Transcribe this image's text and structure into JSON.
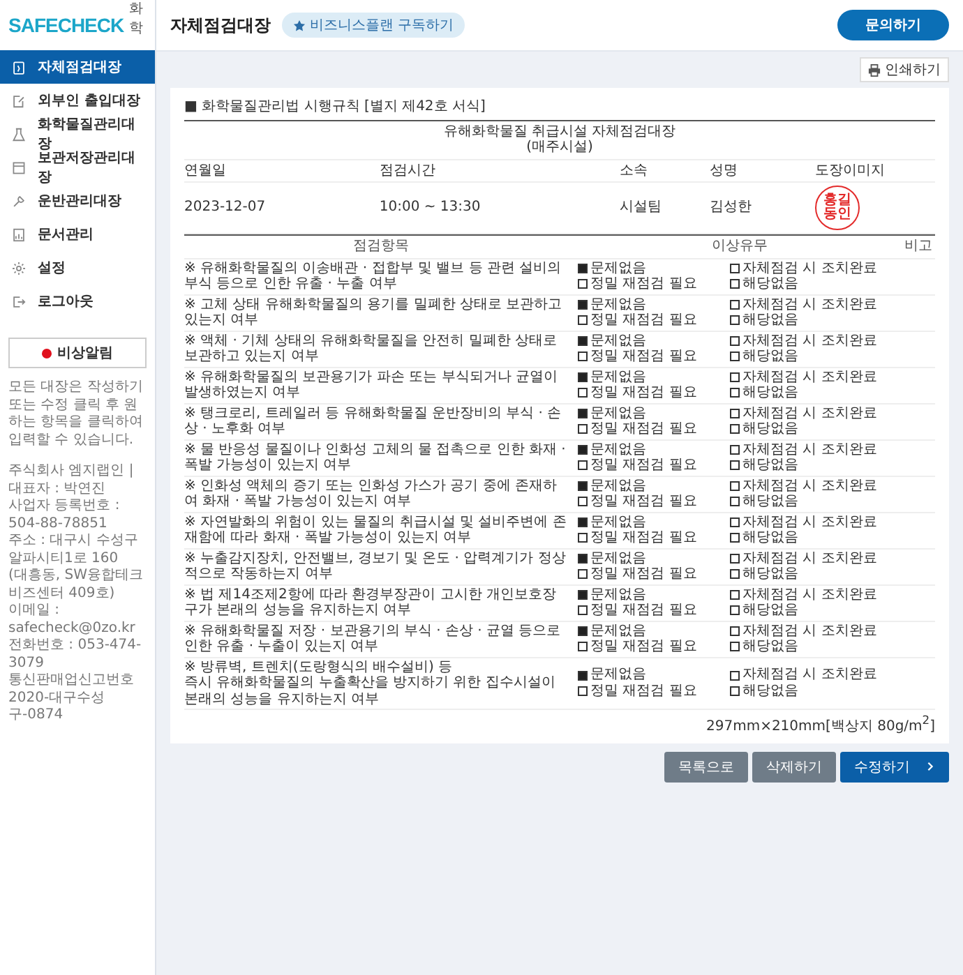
{
  "header": {
    "logo": "SAFECHECK",
    "logo_sub": "화학",
    "page_title": "자체점검대장",
    "subscribe_badge": "비즈니스플랜 구독하기",
    "contact_button": "문의하기"
  },
  "sidebar": {
    "items": [
      {
        "label": "자체점검대장",
        "selected": true
      },
      {
        "label": "외부인 출입대장",
        "selected": false
      },
      {
        "label": "화학물질관리대장",
        "selected": false
      },
      {
        "label": "보관저장관리대장",
        "selected": false
      },
      {
        "label": "운반관리대장",
        "selected": false
      },
      {
        "label": "문서관리",
        "selected": false
      },
      {
        "label": "설정",
        "selected": false
      },
      {
        "label": "로그아웃",
        "selected": false
      }
    ],
    "alert_button": "비상알림",
    "notice": "모든 대장은 작성하기또는 수정 클릭 후 원하는 항목을 클릭하여 입력할 수 있습니다.",
    "company_info": [
      "주식회사 엠지랩인 | 대표자 : 박연진",
      "사업자 등록번호 : 504-88-78851",
      "주소 : 대구시 수성구 알파시티1로 160",
      "(대흥동, SW융합테크비즈센터 409호)",
      "이메일 : safecheck@0zo.kr",
      "전화번호 : 053-474-3079",
      "통신판매업신고번호",
      "2020-대구수성구-0874"
    ]
  },
  "toolbar": {
    "print_button": "인쇄하기"
  },
  "form": {
    "legal_basis": "■ 화학물질관리법 시행규칙 [별지 제42호 서식]",
    "title": "유해화학물질 취급시설 자체점검대장",
    "subtitle": "(매주시설)",
    "info_columns": [
      "연월일",
      "점검시간",
      "소속",
      "성명",
      "도장이미지"
    ],
    "info_values": [
      "2023-12-07",
      "10:00 ~ 13:30",
      "시설팀",
      "김성한"
    ],
    "stamp": [
      "홍길",
      "동인"
    ]
  },
  "checklist": {
    "columns": [
      "점검항목",
      "이상유무",
      "비고"
    ],
    "rows": [
      {
        "item": "※ 유해화학물질의 이송배관 · 접합부 및 밸브 등 관련 설비의 부식 등으로 인한 유출 · 누출 여부",
        "options": [
          {
            "label": "문제없음",
            "checked": true
          },
          {
            "label": "자체점검 시 조치완료",
            "checked": false
          },
          {
            "label": "정밀 재점검 필요",
            "checked": false
          },
          {
            "label": "해당없음",
            "checked": false
          }
        ]
      },
      {
        "item": "※ 고체 상태 유해화학물질의 용기를 밀폐한 상태로 보관하고 있는지 여부",
        "options": [
          {
            "label": "문제없음",
            "checked": true
          },
          {
            "label": "자체점검 시 조치완료",
            "checked": false
          },
          {
            "label": "정밀 재점검 필요",
            "checked": false
          },
          {
            "label": "해당없음",
            "checked": false
          }
        ]
      },
      {
        "item": "※ 액체 · 기체 상태의 유해화학물질을 안전히 밀폐한 상태로 보관하고 있는지 여부",
        "options": [
          {
            "label": "문제없음",
            "checked": true
          },
          {
            "label": "자체점검 시 조치완료",
            "checked": false
          },
          {
            "label": "정밀 재점검 필요",
            "checked": false
          },
          {
            "label": "해당없음",
            "checked": false
          }
        ]
      },
      {
        "item": "※ 유해화학물질의 보관용기가 파손 또는 부식되거나 균열이 발생하였는지 여부",
        "options": [
          {
            "label": "문제없음",
            "checked": true
          },
          {
            "label": "자체점검 시 조치완료",
            "checked": false
          },
          {
            "label": "정밀 재점검 필요",
            "checked": false
          },
          {
            "label": "해당없음",
            "checked": false
          }
        ]
      },
      {
        "item": "※ 탱크로리, 트레일러 등 유해화학물질 운반장비의 부식 · 손상 · 노후화 여부",
        "options": [
          {
            "label": "문제없음",
            "checked": true
          },
          {
            "label": "자체점검 시 조치완료",
            "checked": false
          },
          {
            "label": "정밀 재점검 필요",
            "checked": false
          },
          {
            "label": "해당없음",
            "checked": false
          }
        ]
      },
      {
        "item": "※ 물 반응성 물질이나 인화성 고체의 물 접촉으로 인한 화재 · 폭발 가능성이 있는지 여부",
        "options": [
          {
            "label": "문제없음",
            "checked": true
          },
          {
            "label": "자체점검 시 조치완료",
            "checked": false
          },
          {
            "label": "정밀 재점검 필요",
            "checked": false
          },
          {
            "label": "해당없음",
            "checked": false
          }
        ]
      },
      {
        "item": "※ 인화성 액체의 증기 또는 인화성 가스가 공기 중에 존재하여 화재 · 폭발 가능성이 있는지 여부",
        "options": [
          {
            "label": "문제없음",
            "checked": true
          },
          {
            "label": "자체점검 시 조치완료",
            "checked": false
          },
          {
            "label": "정밀 재점검 필요",
            "checked": false
          },
          {
            "label": "해당없음",
            "checked": false
          }
        ]
      },
      {
        "item": "※ 자연발화의 위험이 있는 물질의 취급시설 및 설비주변에 존재함에 따라 화재 · 폭발 가능성이 있는지 여부",
        "options": [
          {
            "label": "문제없음",
            "checked": true
          },
          {
            "label": "자체점검 시 조치완료",
            "checked": false
          },
          {
            "label": "정밀 재점검 필요",
            "checked": false
          },
          {
            "label": "해당없음",
            "checked": false
          }
        ]
      },
      {
        "item": "※ 누출감지장치, 안전밸브, 경보기 및 온도 · 압력계기가 정상적으로 작동하는지 여부",
        "options": [
          {
            "label": "문제없음",
            "checked": true
          },
          {
            "label": "자체점검 시 조치완료",
            "checked": false
          },
          {
            "label": "정밀 재점검 필요",
            "checked": false
          },
          {
            "label": "해당없음",
            "checked": false
          }
        ]
      },
      {
        "item": "※ 법 제14조제2항에 따라 환경부장관이 고시한 개인보호장구가 본래의 성능을 유지하는지 여부",
        "options": [
          {
            "label": "문제없음",
            "checked": true
          },
          {
            "label": "자체점검 시 조치완료",
            "checked": false
          },
          {
            "label": "정밀 재점검 필요",
            "checked": false
          },
          {
            "label": "해당없음",
            "checked": false
          }
        ]
      },
      {
        "item": "※ 유해화학물질 저장 · 보관용기의 부식 · 손상 · 균열 등으로 인한 유출 · 누출이 있는지 여부",
        "options": [
          {
            "label": "문제없음",
            "checked": true
          },
          {
            "label": "자체점검 시 조치완료",
            "checked": false
          },
          {
            "label": "정밀 재점검 필요",
            "checked": false
          },
          {
            "label": "해당없음",
            "checked": false
          }
        ]
      },
      {
        "item": "※ 방류벽, 트렌치(도랑형식의 배수설비) 등\n즉시 유해화학물질의 누출확산을 방지하기 위한 집수시설이 본래의 성능을 유지하는지 여부",
        "options": [
          {
            "label": "문제없음",
            "checked": true
          },
          {
            "label": "자체점검 시 조치완료",
            "checked": false
          },
          {
            "label": "정밀 재점검 필요",
            "checked": false
          },
          {
            "label": "해당없음",
            "checked": false
          }
        ]
      }
    ]
  },
  "paper_spec": "297mm×210mm[백상지 80g/m$^{2}$]",
  "buttons": [
    {
      "label": "목록으로",
      "kind": "secondary"
    },
    {
      "label": "삭제하기",
      "kind": "secondary"
    },
    {
      "label": "수정하기",
      "kind": "primary"
    }
  ]
}
